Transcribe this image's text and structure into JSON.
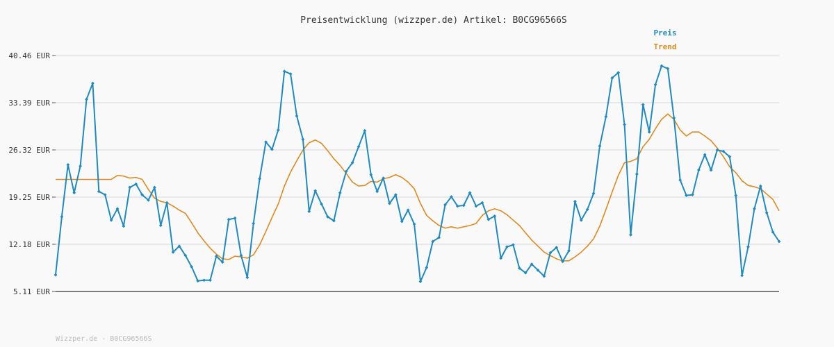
{
  "chart_data": {
    "type": "line",
    "title": "Preisentwicklung (wizzper.de) Artikel: B0CG96566S",
    "xlabel": "",
    "ylabel": "",
    "ylim": [
      5.11,
      40.46
    ],
    "y_ticks": [
      "40.46 EUR",
      "33.39 EUR",
      "26.32 EUR",
      "19.25 EUR",
      "12.18 EUR",
      "5.11 EUR"
    ],
    "y_tick_values": [
      40.46,
      33.39,
      26.32,
      19.25,
      12.18,
      5.11
    ],
    "grid": true,
    "legend_position": "top-right",
    "colors": {
      "preis": "#1f8ac0",
      "trend": "#e08a1e",
      "grid": "#dddddd",
      "axis": "#555555"
    },
    "series": [
      {
        "name": "Preis",
        "values": [
          7.6,
          16.3,
          24.1,
          19.9,
          23.9,
          33.9,
          36.3,
          20.1,
          19.6,
          15.8,
          17.5,
          14.9,
          20.7,
          21.2,
          19.6,
          18.8,
          20.7,
          15.0,
          18.4,
          11.0,
          11.9,
          10.5,
          8.8,
          6.7,
          6.8,
          6.8,
          10.4,
          9.5,
          15.9,
          16.1,
          10.5,
          7.2,
          15.3,
          22.0,
          27.5,
          26.4,
          29.3,
          38.1,
          37.7,
          31.4,
          27.9,
          17.1,
          20.2,
          18.2,
          16.3,
          15.7,
          19.9,
          23.1,
          24.4,
          26.8,
          29.2,
          22.6,
          20.1,
          22.1,
          18.3,
          19.6,
          15.6,
          17.3,
          15.2,
          6.6,
          8.7,
          12.6,
          13.2,
          18.1,
          19.3,
          17.9,
          18.0,
          19.9,
          17.9,
          18.4,
          15.9,
          16.4,
          10.1,
          11.8,
          12.1,
          8.6,
          7.9,
          9.2,
          8.3,
          7.4,
          10.9,
          11.7,
          9.6,
          11.2,
          18.6,
          15.8,
          17.4,
          19.8,
          26.9,
          31.3,
          37.1,
          37.9,
          30.1,
          13.6,
          22.7,
          33.1,
          29.0,
          36.1,
          38.9,
          38.5,
          31.1,
          21.8,
          19.5,
          19.6,
          23.3,
          25.6,
          23.3,
          26.3,
          26.1,
          25.3,
          19.5,
          7.5,
          11.8,
          17.5,
          20.9,
          16.9,
          14.0,
          12.6
        ]
      },
      {
        "name": "Trend",
        "values": [
          21.9,
          21.9,
          21.9,
          21.9,
          21.9,
          21.9,
          21.9,
          21.9,
          21.9,
          21.9,
          22.5,
          22.4,
          22.1,
          22.2,
          21.9,
          20.4,
          19.1,
          18.6,
          18.4,
          17.9,
          17.3,
          16.8,
          15.4,
          13.9,
          12.7,
          11.6,
          10.7,
          10.0,
          9.9,
          10.4,
          10.3,
          10.1,
          10.6,
          12.1,
          14.1,
          16.2,
          18.2,
          20.9,
          23.0,
          24.7,
          26.3,
          27.4,
          27.8,
          27.3,
          26.2,
          25.0,
          24.0,
          22.8,
          21.5,
          20.9,
          21.0,
          21.6,
          21.5,
          22.0,
          22.2,
          22.6,
          22.2,
          21.5,
          20.5,
          18.3,
          16.5,
          15.7,
          15.0,
          14.6,
          14.8,
          14.6,
          14.8,
          15.0,
          15.3,
          16.5,
          17.2,
          17.5,
          17.2,
          16.6,
          15.8,
          15.0,
          13.9,
          12.8,
          11.9,
          11.0,
          10.5,
          10.0,
          9.7,
          9.7,
          10.3,
          11.0,
          11.9,
          13.0,
          14.9,
          17.4,
          20.0,
          22.5,
          24.4,
          24.6,
          25.0,
          26.8,
          27.9,
          29.5,
          30.9,
          31.7,
          30.9,
          29.3,
          28.4,
          29.0,
          29.0,
          28.4,
          27.7,
          26.6,
          25.3,
          23.8,
          22.9,
          21.7,
          21.0,
          20.8,
          20.5,
          19.7,
          18.9,
          17.2
        ]
      }
    ]
  },
  "footer": {
    "text": "Wizzper.de - B0CG96566S"
  }
}
